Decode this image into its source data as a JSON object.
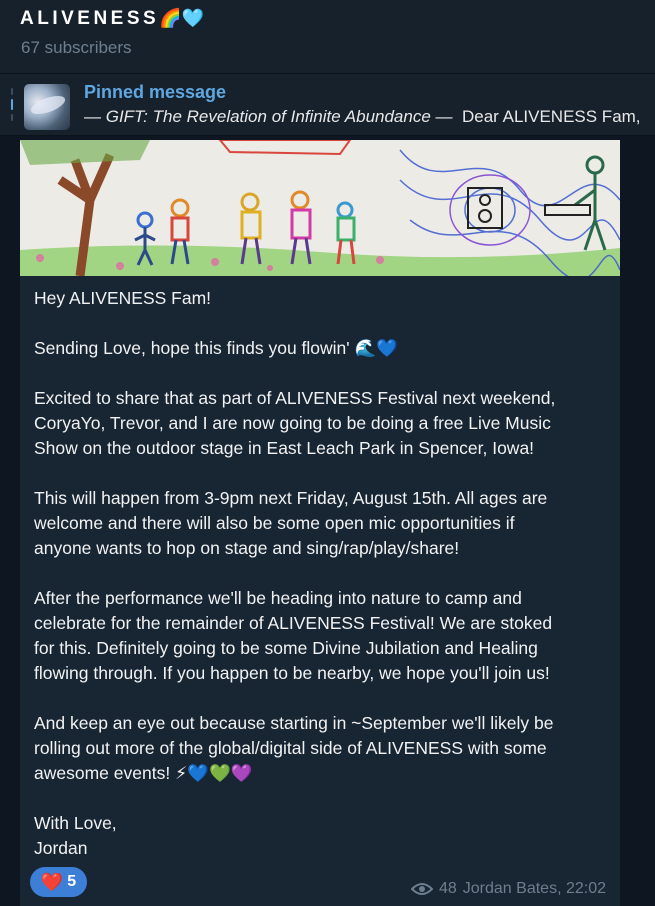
{
  "header": {
    "title": "ALIVENESS",
    "title_emoji": "🌈🩵",
    "subscribers": "67 subscribers"
  },
  "pinned": {
    "label": "Pinned message",
    "preview_italic": "— GIFT: The Revelation of Infinite Abundance —",
    "preview_rest": "Dear ALIVENESS Fam,"
  },
  "message": {
    "paragraphs": [
      [
        "Hey ALIVENESS Fam!"
      ],
      [
        "Sending Love, hope this finds you flowin' 🌊💙"
      ],
      [
        "Excited to share that as part of ALIVENESS Festival next weekend,",
        "CoryaYo, Trevor, and I are now going to be doing a free Live Music",
        "Show on the outdoor stage in East Leach Park in Spencer, Iowa!"
      ],
      [
        "This will happen from 3-9pm next Friday, August 15th. All ages are",
        "welcome and there will also be some open mic opportunities if",
        "anyone wants to hop on stage and sing/rap/play/share!"
      ],
      [
        "After the performance we'll be heading into nature to camp and",
        "celebrate for the remainder of ALIVENESS Festival! We are stoked",
        "for this. Definitely going to be some Divine Jubilation and Healing",
        "flowing through. If you happen to be nearby, we hope you'll join us!"
      ],
      [
        "And keep an eye out because starting in ~September we'll likely be",
        "rolling out more of the global/digital side of ALIVENESS with some",
        "awesome events! ⚡💙💚💜"
      ],
      [
        "With Love,",
        "Jordan"
      ]
    ],
    "reaction": {
      "emoji": "❤️",
      "count": "5"
    },
    "views": "48",
    "author_time": "Jordan Bates, 22:02"
  },
  "colors": {
    "background": "#0e1621",
    "header": "#17212b",
    "bubble": "#182533",
    "accent": "#5fa7e0",
    "reaction": "#3d7ed6",
    "muted": "#6d7f8f"
  },
  "icons": [
    "eye-icon",
    "heart-icon"
  ]
}
